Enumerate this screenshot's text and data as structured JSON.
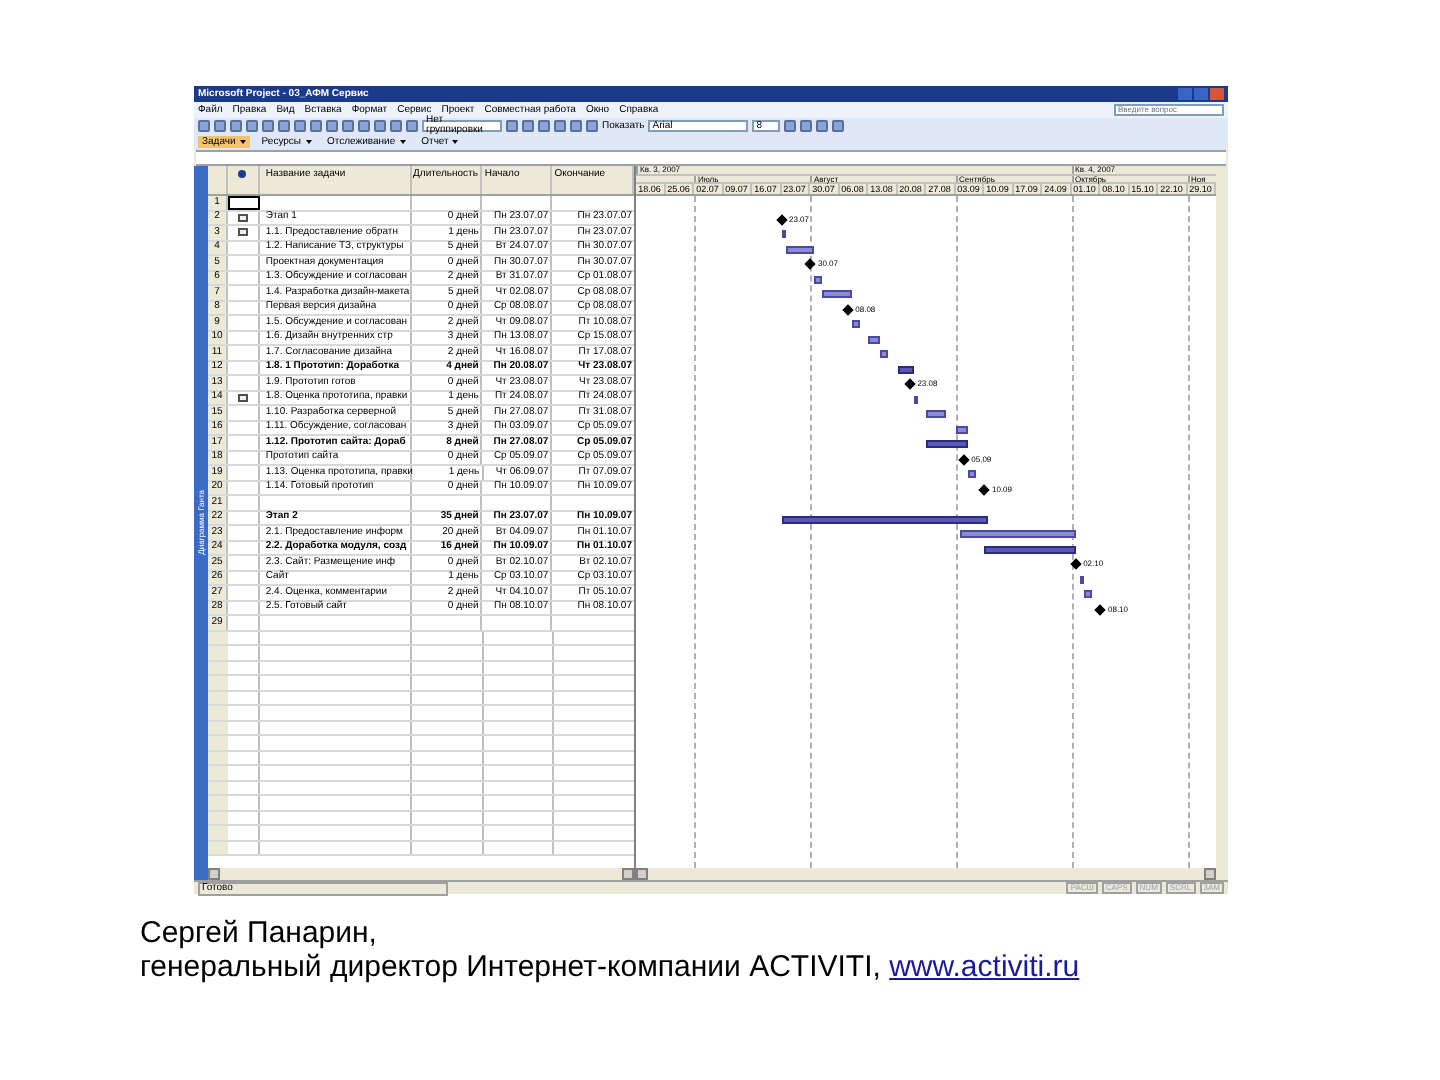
{
  "window": {
    "title": "Microsoft Project - 03_АФМ Сервис",
    "menu": [
      "Файл",
      "Правка",
      "Вид",
      "Вставка",
      "Формат",
      "Сервис",
      "Проект",
      "Совместная работа",
      "Окно",
      "Справка"
    ],
    "question_box": {
      "placeholder": "Введите вопрос"
    },
    "grouping": "Нет группировки",
    "show_button": "Показать",
    "font": "Arial",
    "font_size": "8",
    "guide_tabs": [
      {
        "label": "Задачи",
        "selected": true
      },
      {
        "label": "Ресурсы",
        "selected": false
      },
      {
        "label": "Отслеживание",
        "selected": false
      },
      {
        "label": "Отчет",
        "selected": false
      }
    ],
    "view_bar": "Диаграмма Ганта",
    "columns": [
      "Название задачи",
      "Длительность",
      "Начало",
      "Окончание"
    ],
    "quarters": [
      "Кв. 3, 2007",
      "Кв. 4, 2007"
    ],
    "months": [
      "Июль",
      "Август",
      "Сентябрь",
      "Октябрь",
      "Ноя"
    ],
    "weeks": [
      "18.06",
      "25.06",
      "02.07",
      "09.07",
      "16.07",
      "23.07",
      "30.07",
      "06.08",
      "13.08",
      "20.08",
      "27.08",
      "03.09",
      "10.09",
      "17.09",
      "24.09",
      "01.10",
      "08.10",
      "15.10",
      "22.10",
      "29.10"
    ],
    "rows": [
      {
        "number": "1",
        "kind": "blank",
        "selected": true,
        "note": false
      },
      {
        "number": "2",
        "kind": "milestone",
        "selected": false,
        "note": true,
        "name": "Этап 1",
        "duration": "0 дней",
        "start": "Пн 23.07.07",
        "finish": "Пн 23.07.07",
        "label": "23.07"
      },
      {
        "number": "3",
        "kind": "task",
        "selected": false,
        "note": true,
        "name": "1.1. Предоставление обратн",
        "duration": "1 день",
        "start": "Пн 23.07.07",
        "finish": "Пн 23.07.07"
      },
      {
        "number": "4",
        "kind": "task",
        "selected": false,
        "note": false,
        "name": "1.2. Написание ТЗ, структуры",
        "duration": "5 дней",
        "start": "Вт 24.07.07",
        "finish": "Пн 30.07.07"
      },
      {
        "number": "5",
        "kind": "milestone",
        "selected": false,
        "note": false,
        "name": "Проектная документация",
        "duration": "0 дней",
        "start": "Пн 30.07.07",
        "finish": "Пн 30.07.07",
        "label": "30.07"
      },
      {
        "number": "6",
        "kind": "task",
        "selected": false,
        "note": false,
        "name": "1.3. Обсуждение и согласован",
        "duration": "2 дней",
        "start": "Вт 31.07.07",
        "finish": "Ср 01.08.07"
      },
      {
        "number": "7",
        "kind": "task",
        "selected": false,
        "note": false,
        "name": "1.4. Разработка дизайн-макета",
        "duration": "5 дней",
        "start": "Чт 02.08.07",
        "finish": "Ср 08.08.07"
      },
      {
        "number": "8",
        "kind": "milestone",
        "selected": false,
        "note": false,
        "name": "Первая версия дизайна",
        "duration": "0 дней",
        "start": "Ср 08.08.07",
        "finish": "Ср 08.08.07",
        "label": "08.08"
      },
      {
        "number": "9",
        "kind": "task",
        "selected": false,
        "note": false,
        "name": "1.5. Обсуждение и согласован",
        "duration": "2 дней",
        "start": "Чт 09.08.07",
        "finish": "Пт 10.08.07"
      },
      {
        "number": "10",
        "kind": "task",
        "selected": false,
        "note": false,
        "name": "1.6. Дизайн внутренних стр",
        "duration": "3 дней",
        "start": "Пн 13.08.07",
        "finish": "Ср 15.08.07"
      },
      {
        "number": "11",
        "kind": "task",
        "selected": false,
        "note": false,
        "name": "1.7. Согласование дизайна",
        "duration": "2 дней",
        "start": "Чт 16.08.07",
        "finish": "Пт 17.08.07"
      },
      {
        "number": "12",
        "kind": "summary",
        "selected": false,
        "note": false,
        "name": "1.8. 1 Прототип: Доработка",
        "duration": "4 дней",
        "start": "Пн 20.08.07",
        "finish": "Чт 23.08.07"
      },
      {
        "number": "13",
        "kind": "milestone",
        "selected": false,
        "note": false,
        "name": "1.9. Прототип готов",
        "duration": "0 дней",
        "start": "Чт 23.08.07",
        "finish": "Чт 23.08.07",
        "label": "23.08"
      },
      {
        "number": "14",
        "kind": "task",
        "selected": false,
        "note": true,
        "name": "1.8. Оценка прототипа, правки",
        "duration": "1 день",
        "start": "Пт 24.08.07",
        "finish": "Пт 24.08.07"
      },
      {
        "number": "15",
        "kind": "task",
        "selected": false,
        "note": false,
        "name": "1.10. Разработка серверной",
        "duration": "5 дней",
        "start": "Пн 27.08.07",
        "finish": "Пт 31.08.07"
      },
      {
        "number": "16",
        "kind": "task",
        "selected": false,
        "note": false,
        "name": "1.11. Обсуждение, согласован",
        "duration": "3 дней",
        "start": "Пн 03.09.07",
        "finish": "Ср 05.09.07"
      },
      {
        "number": "17",
        "kind": "summary",
        "selected": false,
        "note": false,
        "name": "1.12. Прототип сайта: Дораб",
        "duration": "8 дней",
        "start": "Пн 27.08.07",
        "finish": "Ср 05.09.07"
      },
      {
        "number": "18",
        "kind": "milestone",
        "selected": false,
        "note": false,
        "name": "Прототип сайта",
        "duration": "0 дней",
        "start": "Ср 05.09.07",
        "finish": "Ср 05.09.07",
        "label": "05.09"
      },
      {
        "number": "19",
        "kind": "task",
        "selected": false,
        "note": false,
        "name": "1.13. Оценка прототипа, правки",
        "duration": "1 день",
        "start": "Чт 06.09.07",
        "finish": "Пт 07.09.07"
      },
      {
        "number": "20",
        "kind": "milestone",
        "selected": false,
        "note": false,
        "name": "1.14. Готовый прототип",
        "duration": "0 дней",
        "start": "Пн 10.09.07",
        "finish": "Пн 10.09.07",
        "label": "10.09"
      },
      {
        "number": "21",
        "kind": "blank",
        "selected": false,
        "note": false
      },
      {
        "number": "22",
        "kind": "summary",
        "selected": false,
        "note": false,
        "name": "Этап 2",
        "duration": "35 дней",
        "start": "Пн 23.07.07",
        "finish": "Пн 10.09.07"
      },
      {
        "number": "23",
        "kind": "task",
        "selected": false,
        "note": false,
        "name": "2.1. Предоставление информ",
        "duration": "20 дней",
        "start": "Вт 04.09.07",
        "finish": "Пн 01.10.07"
      },
      {
        "number": "24",
        "kind": "summary",
        "selected": false,
        "note": false,
        "name": "2.2. Доработка модуля, созд",
        "duration": "16 дней",
        "start": "Пн 10.09.07",
        "finish": "Пн 01.10.07"
      },
      {
        "number": "25",
        "kind": "milestone",
        "selected": false,
        "note": false,
        "name": "2.3. Сайт: Размещение инф",
        "duration": "0 дней",
        "start": "Вт 02.10.07",
        "finish": "Вт 02.10.07",
        "label": "02.10"
      },
      {
        "number": "26",
        "kind": "task",
        "selected": false,
        "note": false,
        "name": "Сайт",
        "duration": "1 день",
        "start": "Ср 03.10.07",
        "finish": "Ср 03.10.07"
      },
      {
        "number": "27",
        "kind": "task",
        "selected": false,
        "note": false,
        "name": "2.4. Оценка, комментарии",
        "duration": "2 дней",
        "start": "Чт 04.10.07",
        "finish": "Пт 05.10.07"
      },
      {
        "number": "28",
        "kind": "milestone",
        "selected": false,
        "note": false,
        "name": "2.5. Готовый сайт",
        "duration": "0 дней",
        "start": "Пн 08.10.07",
        "finish": "Пн 08.10.07",
        "label": "08.10"
      },
      {
        "number": "29",
        "kind": "blank",
        "selected": false,
        "note": false
      }
    ],
    "status": "Готово",
    "indicators": [
      "РАСШ",
      "CAPS",
      "NUM",
      "SCRL",
      "ЗАМ"
    ]
  },
  "caption": {
    "author": "Сергей Панарин,",
    "position": "генеральный директор Интернет-компании ACTIVITI, ",
    "link": "www.activiti.ru"
  }
}
